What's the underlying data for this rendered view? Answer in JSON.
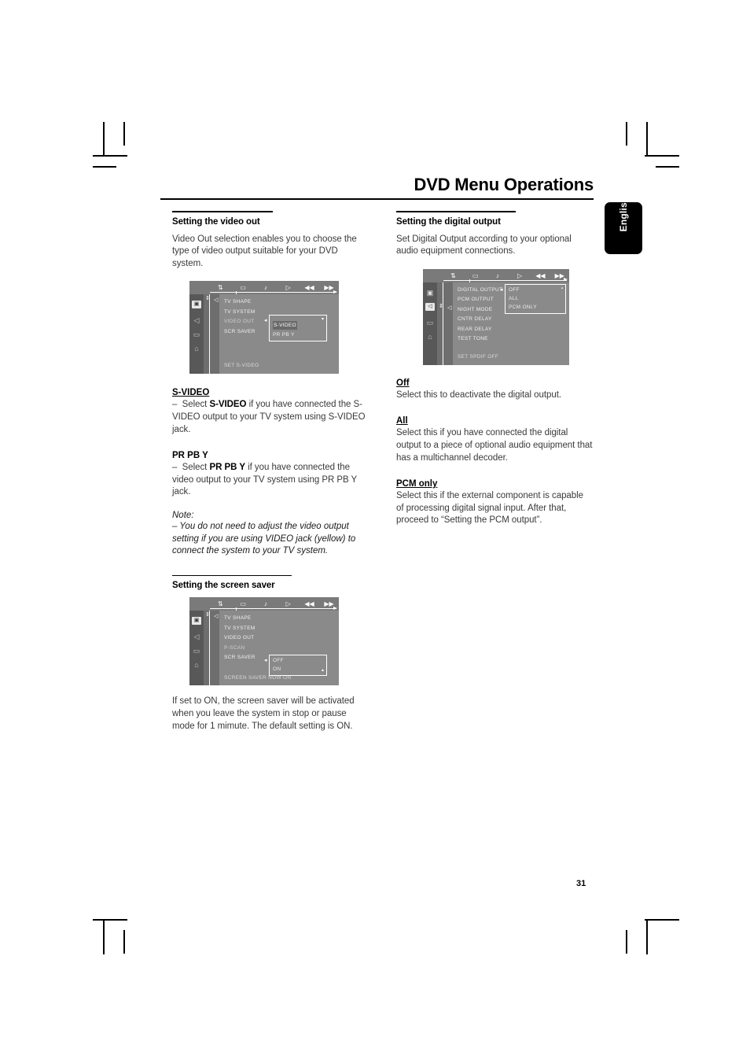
{
  "page": {
    "title": "DVD Menu Operations",
    "language_tab": "English",
    "number": "31"
  },
  "left_column": {
    "section1": {
      "heading": "Setting the video out",
      "intro": "Video Out selection enables you to choose the type of video output suitable for your DVD system.",
      "terms": [
        {
          "term": "S-VIDEO",
          "dash": "–",
          "lead": "Select",
          "strong": "S-VIDEO",
          "rest": "if you have connected the S-VIDEO output to your TV system using S-VIDEO jack."
        },
        {
          "term": "PR PB Y",
          "dash": "–",
          "lead": "Select",
          "strong": "PR PB Y",
          "rest": "if you have connected the video output to your TV system using PR PB Y jack."
        }
      ],
      "note_label": "Note:",
      "note_text": "–  You do not need to adjust the video output setting if you are using VIDEO jack (yellow) to connect the system to your TV system."
    },
    "section2": {
      "heading": "Setting the screen saver",
      "body": "If set to ON, the screen saver will be activated when you leave the system in stop or pause mode for 1 mimute. The default setting is ON."
    }
  },
  "right_column": {
    "section1": {
      "heading": "Setting the digital output",
      "intro": "Set Digital Output according to your optional audio equipment connections.",
      "terms": [
        {
          "term": "Off",
          "body": "Select this to deactivate the digital output."
        },
        {
          "term": "All",
          "body": "Select this if you have connected the digital output to a piece of optional audio equipment that has a multichannel decoder."
        },
        {
          "term": "PCM only",
          "body": "Select this if the external component is capable of processing digital signal input. After that, proceed to “Setting the PCM output”."
        }
      ]
    }
  },
  "osd_video_out": {
    "topbar_icons": [
      "settings-icon",
      "tv-icon",
      "audio-icon",
      "play-icon",
      "rewind-icon",
      "forward-icon"
    ],
    "rail_icons": [
      "tv-picture-icon",
      "speaker-icon",
      "subtitle-icon",
      "preferences-icon"
    ],
    "selected_rail_icon": "tv-picture-icon",
    "menu_items": [
      "TV SHAPE",
      "TV SYSTEM",
      "VIDEO OUT",
      "SCR SAVER"
    ],
    "highlighted_item": "VIDEO OUT",
    "footer": "SET S-VIDEO",
    "popup_options": [
      "S-VIDEO",
      "PR PB Y"
    ],
    "popup_selected": "S-VIDEO",
    "popup_caret": "▾"
  },
  "osd_digital_output": {
    "topbar_icons": [
      "settings-icon",
      "tv-icon",
      "audio-icon",
      "play-icon",
      "rewind-icon",
      "forward-icon"
    ],
    "rail_icons": [
      "tv-picture-icon",
      "speaker-icon",
      "subtitle-icon",
      "preferences-icon"
    ],
    "selected_rail_icon": "speaker-icon",
    "menu_items": [
      "DIGITAL OUTPUT",
      "PCM OUTPUT",
      "NIGHT MODE",
      "CNTR DELAY",
      "REAR DELAY",
      "TEST TONE"
    ],
    "highlighted_item": "DIGITAL OUTPUT",
    "footer": "SET SPDIF OFF",
    "popup_options": [
      "OFF",
      "ALL",
      "PCM ONLY"
    ],
    "popup_selected": "OFF",
    "popup_caret": "▪"
  },
  "osd_screen_saver": {
    "topbar_icons": [
      "settings-icon",
      "tv-icon",
      "audio-icon",
      "play-icon",
      "rewind-icon",
      "forward-icon"
    ],
    "rail_icons": [
      "tv-picture-icon",
      "speaker-icon",
      "subtitle-icon",
      "preferences-icon"
    ],
    "selected_rail_icon": "tv-picture-icon",
    "menu_items": [
      "TV SHAPE",
      "TV SYSTEM",
      "VIDEO OUT",
      "P-SCAN",
      "SCR SAVER"
    ],
    "highlighted_item": "SCR SAVER",
    "footer": "SCREEN SAVER NOW ON",
    "popup_options": [
      "OFF",
      "ON"
    ],
    "popup_selected": "ON",
    "popup_caret": "▴"
  },
  "icon_glyphs": {
    "settings-icon": "↑↓",
    "tv-icon": "▭",
    "audio-icon": "♪",
    "play-icon": "▷",
    "rewind-icon": "◀◀",
    "forward-icon": "▶▶",
    "tv-picture-icon": "▣",
    "speaker-icon": "◁",
    "subtitle-icon": "▭",
    "preferences-icon": "⌂",
    "left-arrow": "◁",
    "up-down": "↕"
  }
}
